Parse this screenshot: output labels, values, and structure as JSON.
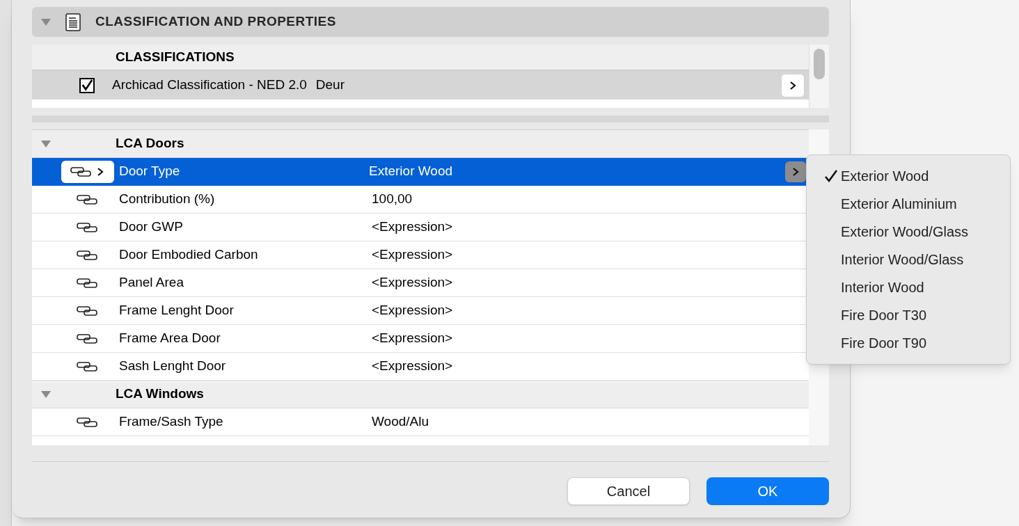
{
  "section": {
    "title": "CLASSIFICATION AND PROPERTIES",
    "expanded": true
  },
  "classifications": {
    "heading": "CLASSIFICATIONS",
    "rows": [
      {
        "checked": true,
        "selected": true,
        "system": "Archicad Classification - NED 2.0",
        "value": "Deur"
      }
    ]
  },
  "property_groups": [
    {
      "name": "LCA Doors",
      "expanded": true,
      "rows": [
        {
          "name": "Door Type",
          "value": "Exterior Wood",
          "selected": true
        },
        {
          "name": "Contribution (%)",
          "value": "100,00",
          "selected": false
        },
        {
          "name": "Door GWP",
          "value": "<Expression>",
          "selected": false
        },
        {
          "name": "Door Embodied Carbon",
          "value": "<Expression>",
          "selected": false
        },
        {
          "name": "Panel Area",
          "value": "<Expression>",
          "selected": false
        },
        {
          "name": "Frame Lenght Door",
          "value": "<Expression>",
          "selected": false
        },
        {
          "name": "Frame Area Door",
          "value": "<Expression>",
          "selected": false
        },
        {
          "name": "Sash Lenght Door",
          "value": "<Expression>",
          "selected": false
        }
      ]
    },
    {
      "name": "LCA Windows",
      "expanded": true,
      "rows": [
        {
          "name": "Frame/Sash Type",
          "value": "Wood/Alu",
          "selected": false
        }
      ]
    }
  ],
  "dropdown_menu": [
    {
      "label": "Exterior Wood",
      "checked": true
    },
    {
      "label": "Exterior Aluminium",
      "checked": false
    },
    {
      "label": "Exterior Wood/Glass",
      "checked": false
    },
    {
      "label": "Interior Wood/Glass",
      "checked": false
    },
    {
      "label": "Interior Wood",
      "checked": false
    },
    {
      "label": "Fire Door T30",
      "checked": false
    },
    {
      "label": "Fire Door T90",
      "checked": false
    }
  ],
  "buttons": [
    {
      "label": "Cancel",
      "kind": "secondary"
    },
    {
      "label": "OK",
      "kind": "primary"
    }
  ]
}
